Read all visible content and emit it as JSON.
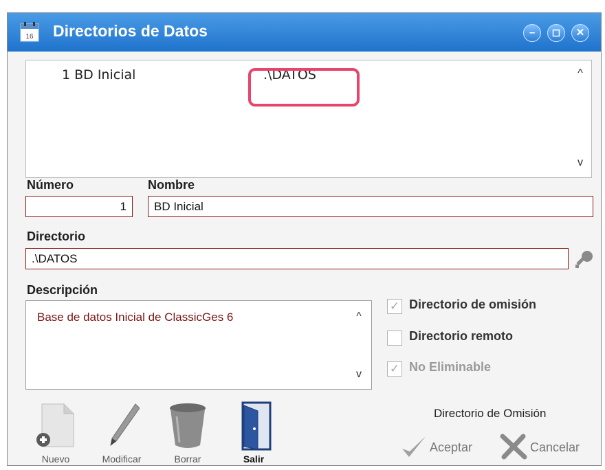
{
  "window": {
    "title": "Directorios de Datos",
    "buttons": {
      "minimize": "–",
      "maximize": "◻",
      "close": "✕"
    }
  },
  "list": {
    "rows": [
      {
        "number_name": "1 BD Inicial",
        "directory": ".\\DATOS"
      }
    ],
    "scroll_up": "^",
    "scroll_down": "v"
  },
  "form": {
    "numero_label": "Número",
    "numero_value": "1",
    "nombre_label": "Nombre",
    "nombre_value": "BD Inicial",
    "directorio_label": "Directorio",
    "directorio_value": ".\\DATOS",
    "descripcion_label": "Descripción",
    "descripcion_value": "Base de datos Inicial de ClassicGes 6"
  },
  "options": {
    "omision_label": "Directorio de omisión",
    "omision_checked": true,
    "remoto_label": "Directorio remoto",
    "remoto_checked": false,
    "no_eliminable_label": "No Eliminable",
    "no_eliminable_checked": true
  },
  "toolbar": {
    "nuevo_label": "Nuevo",
    "modificar_label": "Modificar",
    "borrar_label": "Borrar",
    "salir_label": "Salir"
  },
  "status_note": "Directorio de Omisión",
  "actions": {
    "aceptar_label": "Aceptar",
    "cancelar_label": "Cancelar"
  },
  "colors": {
    "titlebar": "#1f73cc",
    "field_border": "#8b1a1a",
    "highlight": "#e8456e"
  }
}
